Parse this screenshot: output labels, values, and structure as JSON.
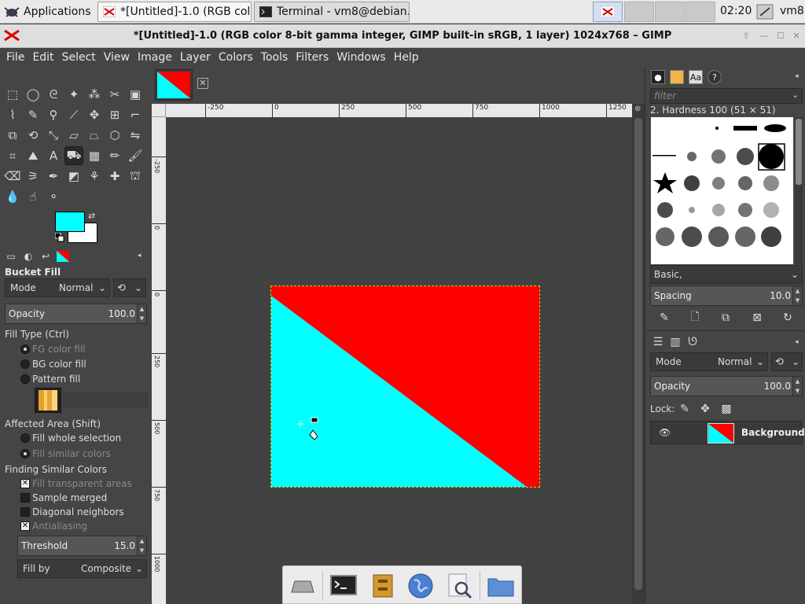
{
  "taskbar": {
    "applications_label": "Applications",
    "window1_label": "*[Untitled]-1.0 (RGB col...",
    "window2_label": "Terminal - vm8@debian...",
    "clock": "02:20",
    "user": "vm8"
  },
  "window": {
    "title": "*[Untitled]-1.0 (RGB color 8-bit gamma integer, GIMP built-in sRGB, 1 layer) 1024x768 – GIMP"
  },
  "menubar": [
    "File",
    "Edit",
    "Select",
    "View",
    "Image",
    "Layer",
    "Colors",
    "Tools",
    "Filters",
    "Windows",
    "Help"
  ],
  "colors": {
    "fg": "#00ffff",
    "bg": "#ffffff",
    "accent_red": "#ff0000"
  },
  "tool_options": {
    "title": "Bucket Fill",
    "mode_label": "Mode",
    "mode_value": "Normal",
    "opacity_label": "Opacity",
    "opacity_value": "100.0",
    "fill_type_label": "Fill Type  (Ctrl)",
    "fill_fg": "FG color fill",
    "fill_bg": "BG color fill",
    "fill_pattern": "Pattern fill",
    "affected_label": "Affected Area  (Shift)",
    "affected_whole": "Fill whole selection",
    "affected_similar": "Fill similar colors",
    "finding_label": "Finding Similar Colors",
    "fill_transparent": "Fill transparent areas",
    "sample_merged": "Sample merged",
    "diagonal": "Diagonal neighbors",
    "antialiasing": "Antialiasing",
    "threshold_label": "Threshold",
    "threshold_value": "15.0",
    "fillby_label": "Fill by",
    "fillby_value": "Composite"
  },
  "ruler": {
    "h_labels": [
      "-250",
      "0",
      "250",
      "500",
      "750",
      "1000",
      "1250"
    ],
    "v_labels": [
      "-250",
      "0",
      "250",
      "500",
      "750",
      "1000"
    ]
  },
  "brushes": {
    "filter_placeholder": "filter",
    "selected_name": "2. Hardness 100 (51 × 51)",
    "preset": "Basic,",
    "spacing_label": "Spacing",
    "spacing_value": "10.0"
  },
  "layers": {
    "mode_label": "Mode",
    "mode_value": "Normal",
    "opacity_label": "Opacity",
    "opacity_value": "100.0",
    "lock_label": "Lock:",
    "layer_name": "Background"
  }
}
